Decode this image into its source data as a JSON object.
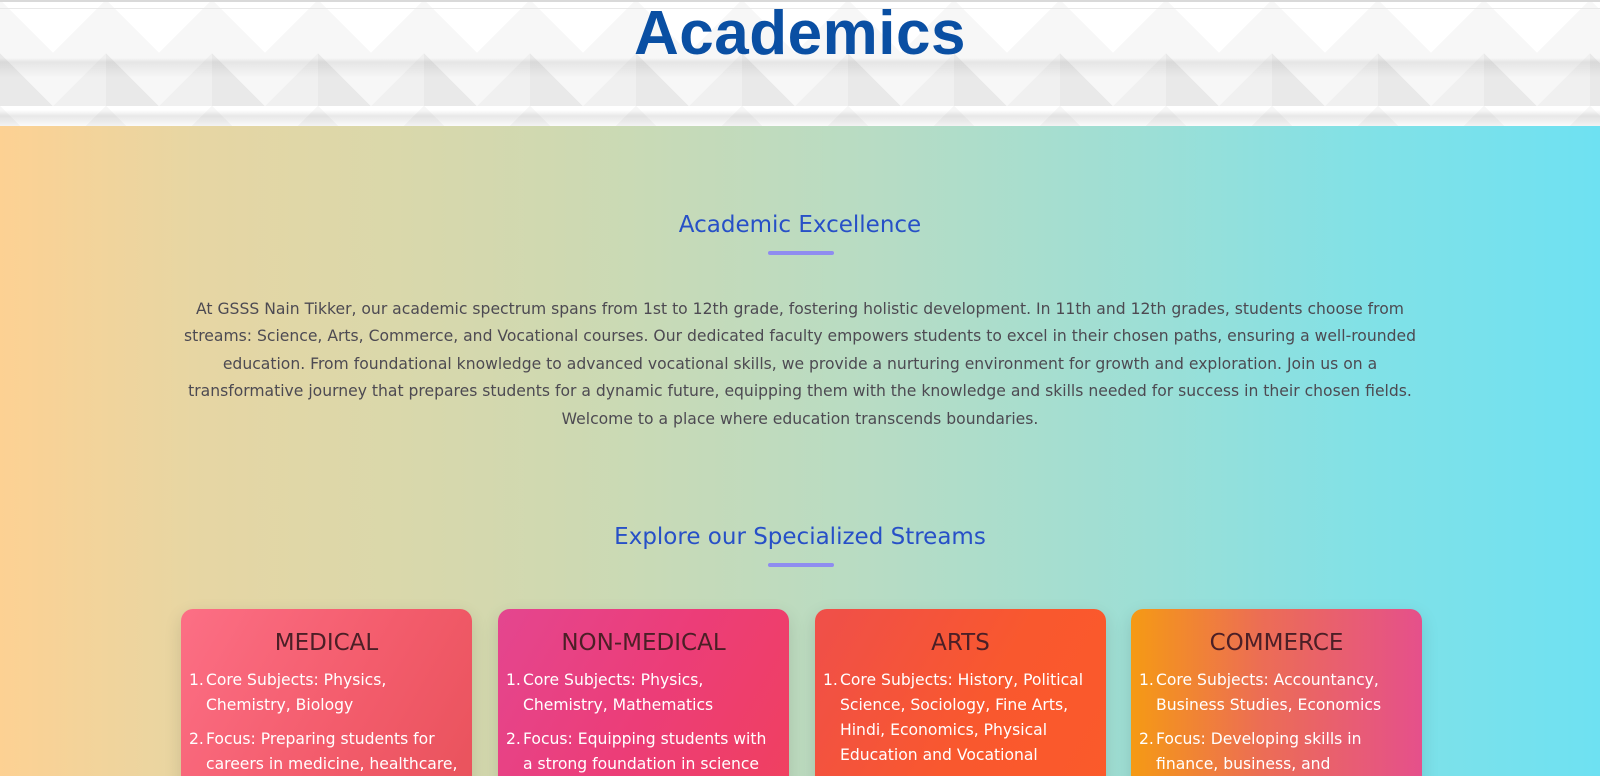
{
  "header": {
    "title": "Academics"
  },
  "excellence": {
    "title": "Academic Excellence",
    "intro": "At GSSS Nain Tikker, our academic spectrum spans from 1st to 12th grade, fostering holistic development. In 11th and 12th grades, students choose from streams: Science, Arts, Commerce, and Vocational courses. Our dedicated faculty empowers students to excel in their chosen paths, ensuring a well-rounded education. From foundational knowledge to advanced vocational skills, we provide a nurturing environment for growth and exploration. Join us on a transformative journey that prepares students for a dynamic future, equipping them with the knowledge and skills needed for success in their chosen fields. Welcome to a place where education transcends boundaries."
  },
  "streams": {
    "title": "Explore our Specialized Streams",
    "cards": [
      {
        "title": "MEDICAL",
        "items": [
          "Core Subjects: Physics, Chemistry, Biology",
          "Focus: Preparing students for careers in medicine, healthcare,"
        ]
      },
      {
        "title": "NON-MEDICAL",
        "items": [
          "Core Subjects: Physics, Chemistry, Mathematics",
          "Focus: Equipping students with a strong foundation in science"
        ]
      },
      {
        "title": "ARTS",
        "items": [
          "Core Subjects: History, Political Science, Sociology, Fine Arts, Hindi, Economics, Physical Education and Vocational"
        ]
      },
      {
        "title": "COMMERCE",
        "items": [
          "Core Subjects: Accountancy, Business Studies, Economics",
          "Focus: Developing skills in finance, business, and"
        ]
      }
    ]
  },
  "colors": {
    "title_blue": "#0a4fa3",
    "section_title": "#2750c7",
    "underline": "#8f8cf0",
    "body_text": "#4d4a52"
  }
}
